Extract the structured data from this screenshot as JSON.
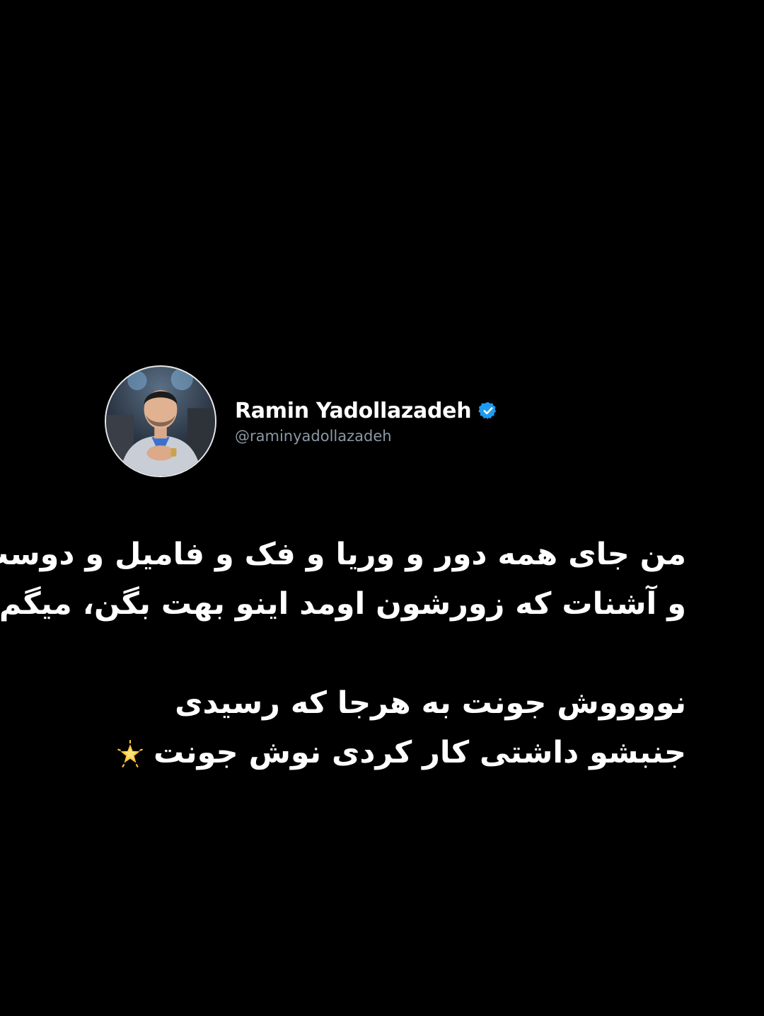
{
  "author": {
    "display_name": "Ramin Yadollazadeh",
    "handle": "@raminyadollazadeh",
    "verified": true,
    "avatar_icon": "profile-photo",
    "verified_icon": "verified-badge-icon",
    "verified_color": "#1d9bf0"
  },
  "tweet": {
    "lines": [
      "من جای همه دور و وریا و فک و فامیل و دوست",
      "و آشنات که زورشون اومد اینو بهت بگن، میگم",
      "",
      "نووووش جونت به هرجا که رسیدی",
      "جنبشو داشتی کار کردی نوش جونت"
    ],
    "trailing_emoji": "glowing-star-icon"
  },
  "colors": {
    "background": "#000000",
    "text": "#ffffff",
    "secondary_text": "#8b98a5"
  }
}
